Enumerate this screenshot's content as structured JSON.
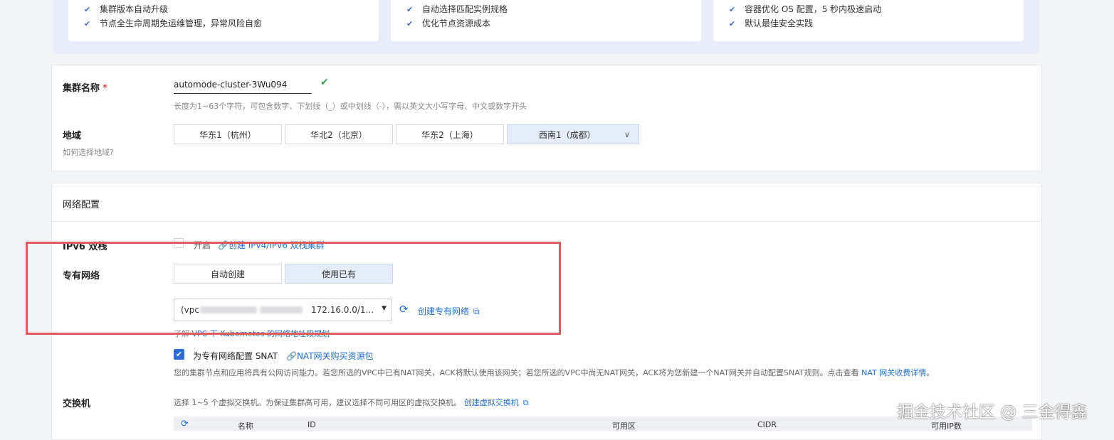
{
  "features": [
    {
      "lines": [
        "集群版本自动升级",
        "节点全生命周期免运维管理，异常风险自愈"
      ]
    },
    {
      "lines": [
        "自动选择匹配实例规格",
        "优化节点资源成本"
      ]
    },
    {
      "lines": [
        "容器优化 OS 配置，5 秒内极速启动",
        "默认最佳安全实践"
      ]
    }
  ],
  "basic": {
    "cluster_name_label": "集群名称",
    "required_mark": "*",
    "cluster_name_value": "automode-cluster-3Wu094",
    "cluster_name_hint": "长度为1~63个字符，可包含数字、下划线（_）或中划线（-），需以英文大小写字母、中文或数字开头",
    "region_label": "地域",
    "region_help": "如何选择地域?",
    "regions": [
      "华东1（杭州）",
      "华北2（北京）",
      "华东2（上海）",
      "西南1（成都）"
    ],
    "region_selected": "西南1（成都）"
  },
  "network": {
    "title": "网络配置",
    "ipv6_label": "IPv6 双栈",
    "ipv6_option": "开启",
    "ipv6_link": "创建 IPv4/IPv6 双栈集群",
    "vpc_label": "专有网络",
    "vpc_modes": [
      "自动创建",
      "使用已有"
    ],
    "vpc_mode_selected": "使用已有",
    "vpc_select_prefix": "(vpc",
    "vpc_select_cidr": "172.16.0.0/1...",
    "create_vpc_link": "创建专有网络",
    "learn_prefix": "了解",
    "learn_link": "VPC 下 Kubernetes 的网络地址段规划",
    "snat_label": "为专有网络配置 SNAT",
    "snat_link": "NAT网关购买资源包",
    "snat_desc": "您的集群节点和应用将具有公网访问能力。若您所选的VPC中已有NAT网关，ACK将默认使用该网关；若您所选的VPC中尚无NAT网关，ACK将为您新建一个NAT网关并自动配置SNAT规则。点击查看",
    "snat_desc_link": "NAT 网关收费详情",
    "snat_desc_end": "。",
    "vswitch_label": "交换机",
    "vswitch_hint": "选择 1~5 个虚拟交换机。为保证集群高可用，建议选择不同可用区的虚拟交换机。",
    "vswitch_link": "创建虚拟交换机",
    "table_columns": [
      "名称",
      "ID",
      "可用区",
      "CIDR",
      "可用IP数"
    ]
  },
  "watermark": "掘金技术社区 @ 三金得鑫",
  "colors": {
    "accent": "#1f6fd6",
    "highlight": "#e05b5b",
    "success": "#2ea14a"
  }
}
